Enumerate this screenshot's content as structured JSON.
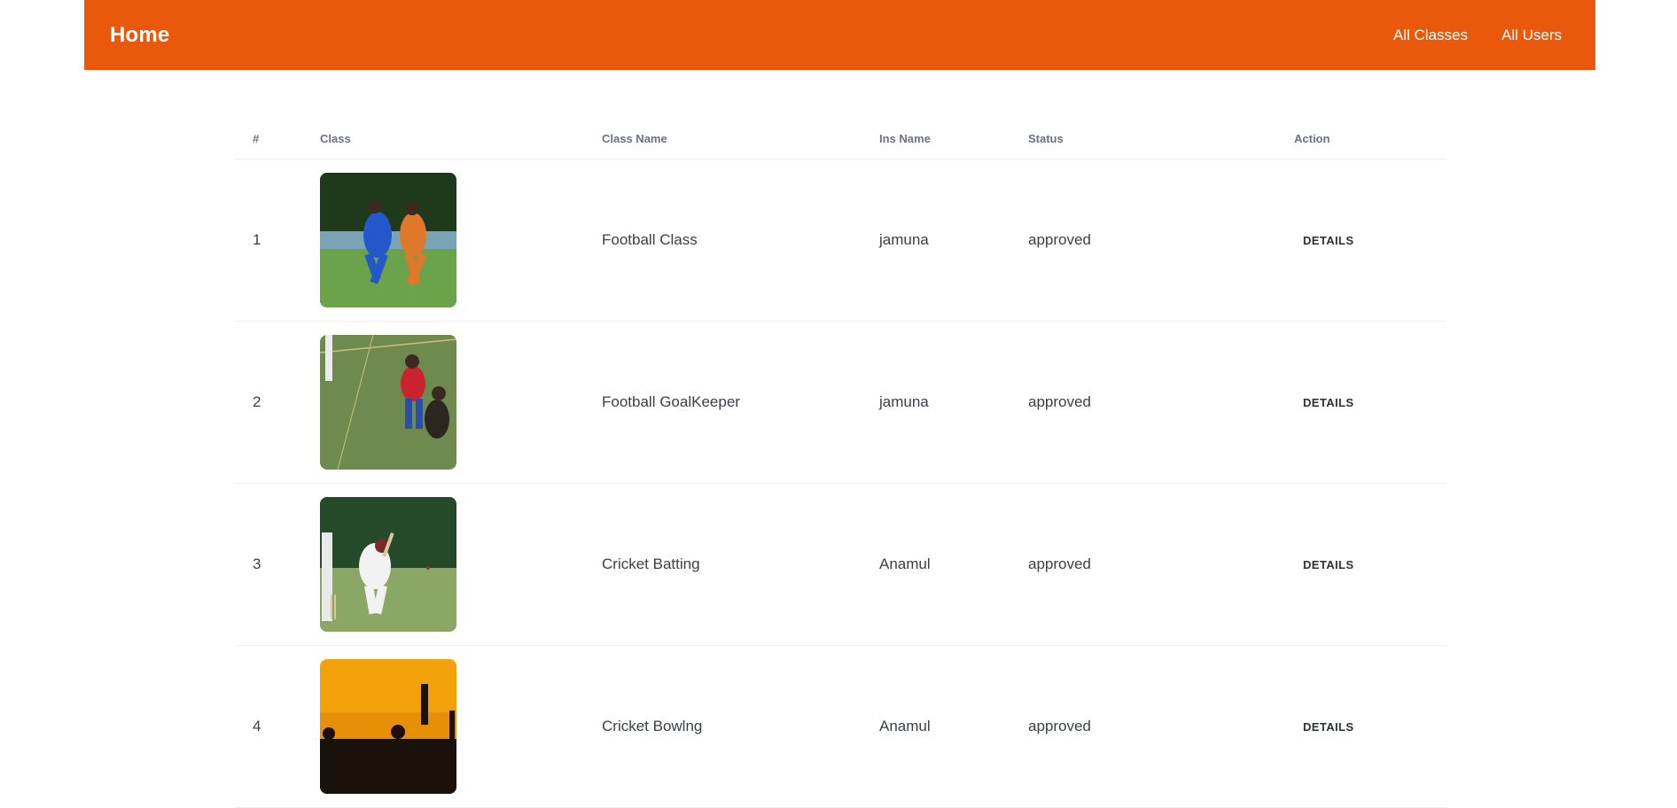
{
  "nav": {
    "brand": "Home",
    "links": [
      "All Classes",
      "All Users"
    ]
  },
  "table": {
    "headers": [
      "#",
      "Class",
      "Class Name",
      "Ins Name",
      "Status",
      "Action"
    ],
    "rows": [
      {
        "index": "1",
        "image": "football-players-image",
        "class_name": "Football Class",
        "ins_name": "jamuna",
        "status": "approved",
        "action": "DETAILS"
      },
      {
        "index": "2",
        "image": "football-goalkeeper-image",
        "class_name": "Football GoalKeeper",
        "ins_name": "jamuna",
        "status": "approved",
        "action": "DETAILS"
      },
      {
        "index": "3",
        "image": "cricket-batting-image",
        "class_name": "Cricket Batting",
        "ins_name": "Anamul",
        "status": "approved",
        "action": "DETAILS"
      },
      {
        "index": "4",
        "image": "cricket-bowling-image",
        "class_name": "Cricket Bowlng",
        "ins_name": "Anamul",
        "status": "approved",
        "action": "DETAILS"
      }
    ]
  },
  "colors": {
    "navbar": "#ea580c",
    "header_text": "#6b7280",
    "row_border": "#eef0f2"
  }
}
